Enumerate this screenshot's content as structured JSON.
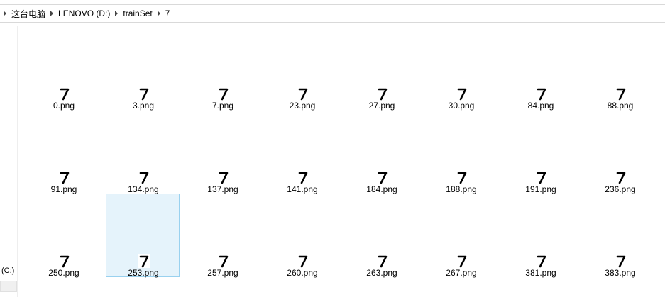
{
  "breadcrumb": [
    "这台电脑",
    "LENOVO (D:)",
    "trainSet",
    "7"
  ],
  "sidebar": {
    "drive_label": "(C:)"
  },
  "files": [
    {
      "name": "0.png"
    },
    {
      "name": "3.png"
    },
    {
      "name": "7.png"
    },
    {
      "name": "23.png"
    },
    {
      "name": "27.png"
    },
    {
      "name": "30.png"
    },
    {
      "name": "84.png"
    },
    {
      "name": "88.png"
    },
    {
      "name": "91.png"
    },
    {
      "name": "134.png"
    },
    {
      "name": "137.png"
    },
    {
      "name": "141.png"
    },
    {
      "name": "184.png"
    },
    {
      "name": "188.png"
    },
    {
      "name": "191.png"
    },
    {
      "name": "236.png"
    },
    {
      "name": "250.png"
    },
    {
      "name": "253.png",
      "selected": true
    },
    {
      "name": "257.png"
    },
    {
      "name": "260.png"
    },
    {
      "name": "263.png"
    },
    {
      "name": "267.png"
    },
    {
      "name": "381.png"
    },
    {
      "name": "383.png"
    }
  ],
  "icons": {
    "separator": "chevron-right-icon",
    "thumbnail": "digit-seven-thumbnail-icon"
  },
  "colors": {
    "selection_bg": "#e5f3fb",
    "selection_border": "#99d1ef"
  }
}
